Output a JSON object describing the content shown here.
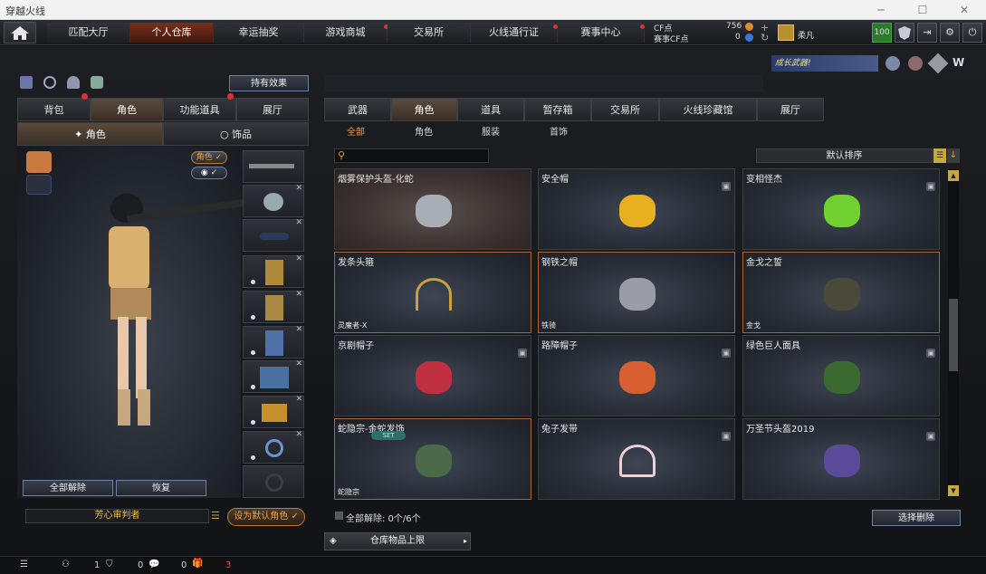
{
  "window": {
    "title": "穿越火线",
    "minimize": "─",
    "maximize": "☐",
    "close": "✕"
  },
  "topnav": {
    "tabs": [
      "匹配大厅",
      "个人仓库",
      "幸运抽奖",
      "游戏商城",
      "交易所",
      "火线通行证",
      "赛事中心"
    ],
    "active_index": 1,
    "cf_label": "CF点",
    "cf_value": "756",
    "match_cf_label": "赛事CF点",
    "match_cf_value": "0",
    "username": "柔凡",
    "level_badge": "100"
  },
  "left": {
    "effects_button": "持有效果",
    "tabs": [
      "背包",
      "角色",
      "功能道具",
      "展厅"
    ],
    "active_tab": 1,
    "subtabs": [
      "角色",
      "饰品"
    ],
    "active_subtab": 0,
    "toggle_role": "角色",
    "unequip_all": "全部解除",
    "restore": "恢复",
    "character_name": "芳心审判者",
    "set_default": "设为默认角色"
  },
  "right": {
    "tabs": [
      "武器",
      "角色",
      "道具",
      "暂存箱",
      "交易所",
      "火线珍藏馆",
      "展厅"
    ],
    "active_tab": 1,
    "subtabs": [
      "全部",
      "角色",
      "服装",
      "首饰"
    ],
    "active_subtab": 0,
    "sort_label": "默认排序",
    "search_placeholder": "",
    "items": [
      {
        "name": "烟雾保护头盔-化蛇",
        "tag": "",
        "lock": false,
        "style": "sel",
        "icon": "helmet-icon"
      },
      {
        "name": "安全帽",
        "tag": "",
        "lock": true,
        "style": "",
        "icon": "hardhat-icon"
      },
      {
        "name": "变相怪杰",
        "tag": "",
        "lock": true,
        "style": "",
        "icon": "green-mask-icon"
      },
      {
        "name": "发条头箍",
        "tag": "灵魔者-X",
        "lock": false,
        "style": "gold",
        "icon": "wind-headband-icon"
      },
      {
        "name": "钢铁之帽",
        "tag": "铁骑",
        "lock": false,
        "style": "gold",
        "icon": "steel-hat-icon"
      },
      {
        "name": "金戈之誓",
        "tag": "金戈",
        "lock": false,
        "style": "gold",
        "icon": "officer-cap-icon"
      },
      {
        "name": "京剧帽子",
        "tag": "",
        "lock": true,
        "style": "",
        "icon": "opera-hat-icon"
      },
      {
        "name": "路障帽子",
        "tag": "",
        "lock": true,
        "style": "",
        "icon": "traffic-cone-icon"
      },
      {
        "name": "绿色巨人面具",
        "tag": "",
        "lock": true,
        "style": "",
        "icon": "hulk-mask-icon"
      },
      {
        "name": "蛇隐宗-金蛇发饰",
        "tag": "蛇隐宗",
        "lock": false,
        "style": "gold",
        "icon": "snake-hairpiece-icon",
        "badge": "SET"
      },
      {
        "name": "兔子发带",
        "tag": "",
        "lock": true,
        "style": "",
        "icon": "bunny-ears-icon"
      },
      {
        "name": "万圣节头盔2019",
        "tag": "",
        "lock": true,
        "style": "",
        "icon": "witch-hat-icon"
      }
    ],
    "unequip_count_label": "全部解除: 0个/6个",
    "select_delete": "选择删除",
    "warehouse_limit": "仓库物品上限",
    "growth_banner": "成长武器!"
  },
  "bottom": {
    "count1": "1",
    "count2": "0",
    "count3": "0",
    "count4": "3"
  },
  "colors": {
    "accent": "#f0a040",
    "active_tab": "#7a2f1a",
    "gold_border": "#b0622c"
  }
}
